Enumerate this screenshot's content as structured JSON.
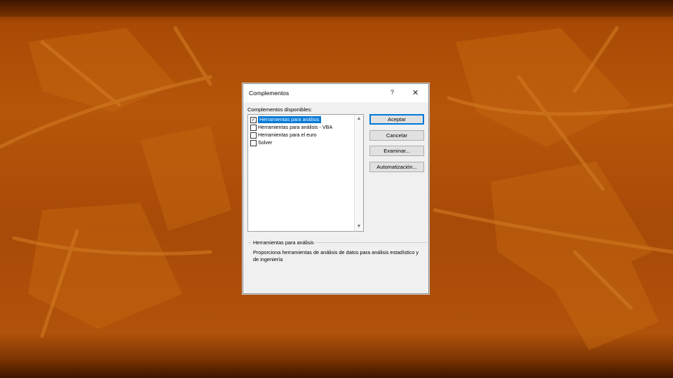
{
  "dialog": {
    "title": "Complementos",
    "help_label": "?",
    "close_label": "✕",
    "available_label": "Complementos disponibles:",
    "addins": [
      {
        "label": "Herramientas para análisis",
        "checked": true,
        "selected": true
      },
      {
        "label": "Herramientas para análisis - VBA",
        "checked": false,
        "selected": false
      },
      {
        "label": "Herramientas para el euro",
        "checked": false,
        "selected": false
      },
      {
        "label": "Solver",
        "checked": false,
        "selected": false
      }
    ],
    "buttons": {
      "ok": "Aceptar",
      "cancel": "Cancelar",
      "browse": "Examinar...",
      "automation": "Automatización..."
    },
    "scroll_up_icon": "▲",
    "scroll_down_icon": "▼",
    "description_title": "Herramientas para análisis",
    "description_text": "Proporciona herramientas de análisis de datos para análisis estadístico y de ingeniería"
  },
  "colors": {
    "background": "#b5560a",
    "selection": "#0078d7"
  }
}
